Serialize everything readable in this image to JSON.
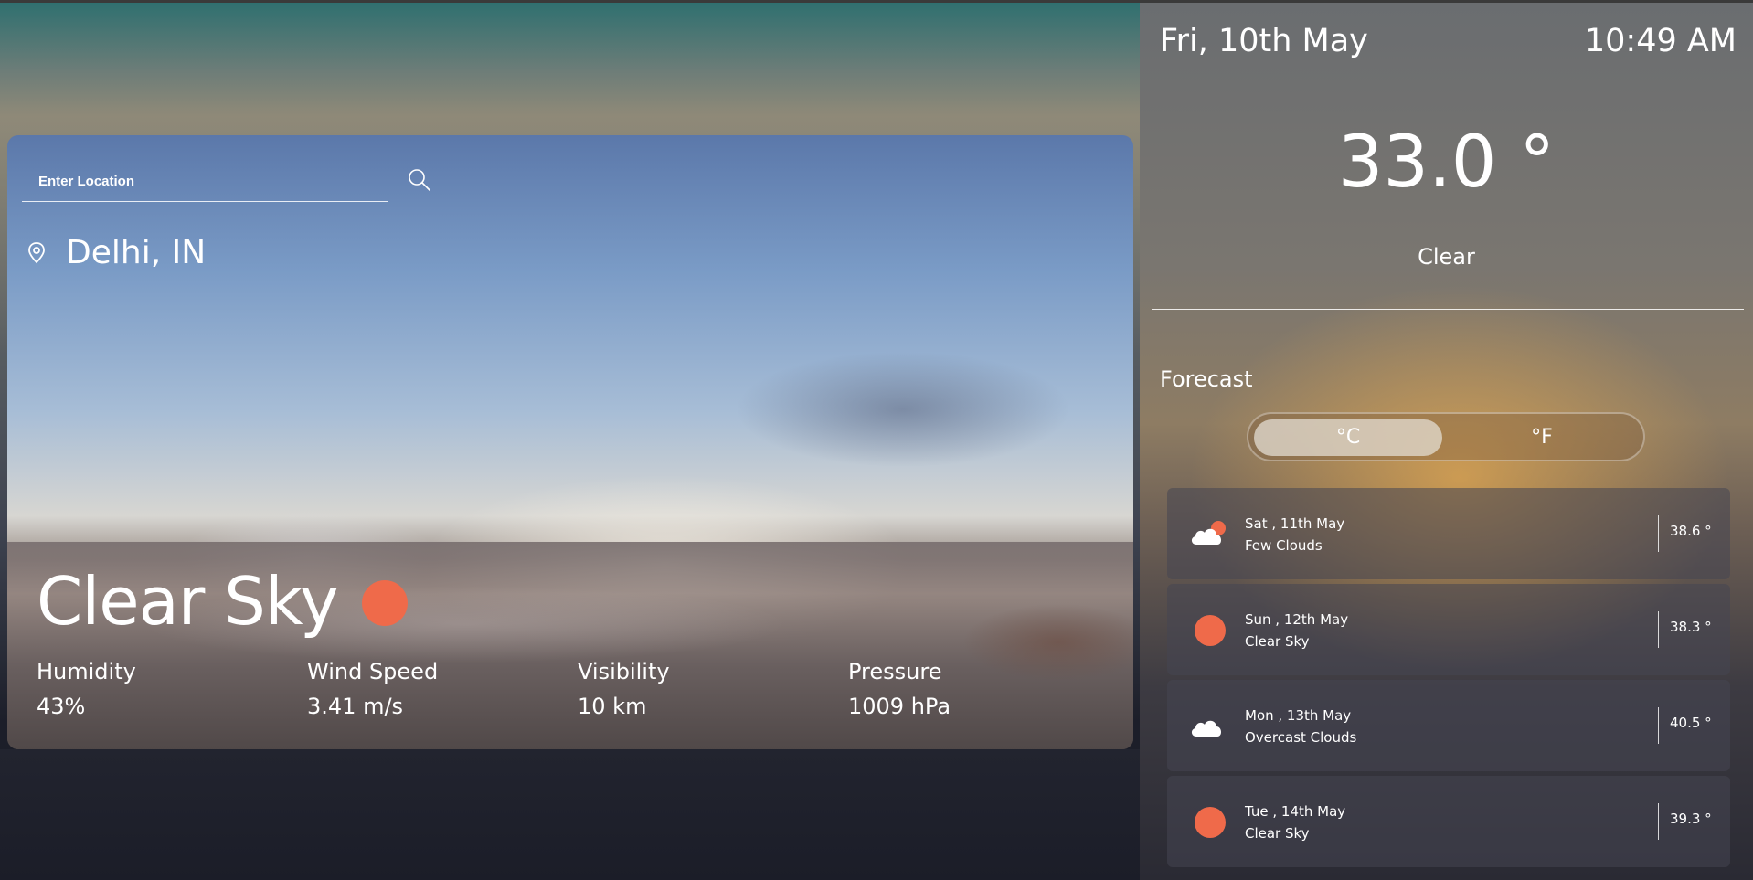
{
  "search": {
    "placeholder": "Enter Location"
  },
  "location": {
    "name": "Delhi, IN"
  },
  "current": {
    "condition": "Clear Sky",
    "stats": [
      {
        "label": "Humidity",
        "value": "43%"
      },
      {
        "label": "Wind Speed",
        "value": "3.41 m/s"
      },
      {
        "label": "Visibility",
        "value": "10 km"
      },
      {
        "label": "Pressure",
        "value": "1009 hPa"
      }
    ]
  },
  "panel": {
    "date": "Fri, 10th May",
    "time": "10:49 AM",
    "temperature": "33.0 °",
    "description": "Clear",
    "forecast_title": "Forecast",
    "units": {
      "celsius": "°C",
      "fahrenheit": "°F",
      "selected": "°C"
    },
    "forecast": [
      {
        "date": "Sat , 11th May",
        "condition": "Few Clouds",
        "temp": "38.6 °",
        "icon": "few-clouds-icon"
      },
      {
        "date": "Sun , 12th May",
        "condition": "Clear Sky",
        "temp": "38.3 °",
        "icon": "sun-icon"
      },
      {
        "date": "Mon , 13th May",
        "condition": "Overcast Clouds",
        "temp": "40.5 °",
        "icon": "cloud-icon"
      },
      {
        "date": "Tue , 14th May",
        "condition": "Clear Sky",
        "temp": "39.3 °",
        "icon": "sun-icon"
      }
    ]
  },
  "colors": {
    "sun": "#ef6a4a",
    "accent_text": "#ffffff"
  }
}
